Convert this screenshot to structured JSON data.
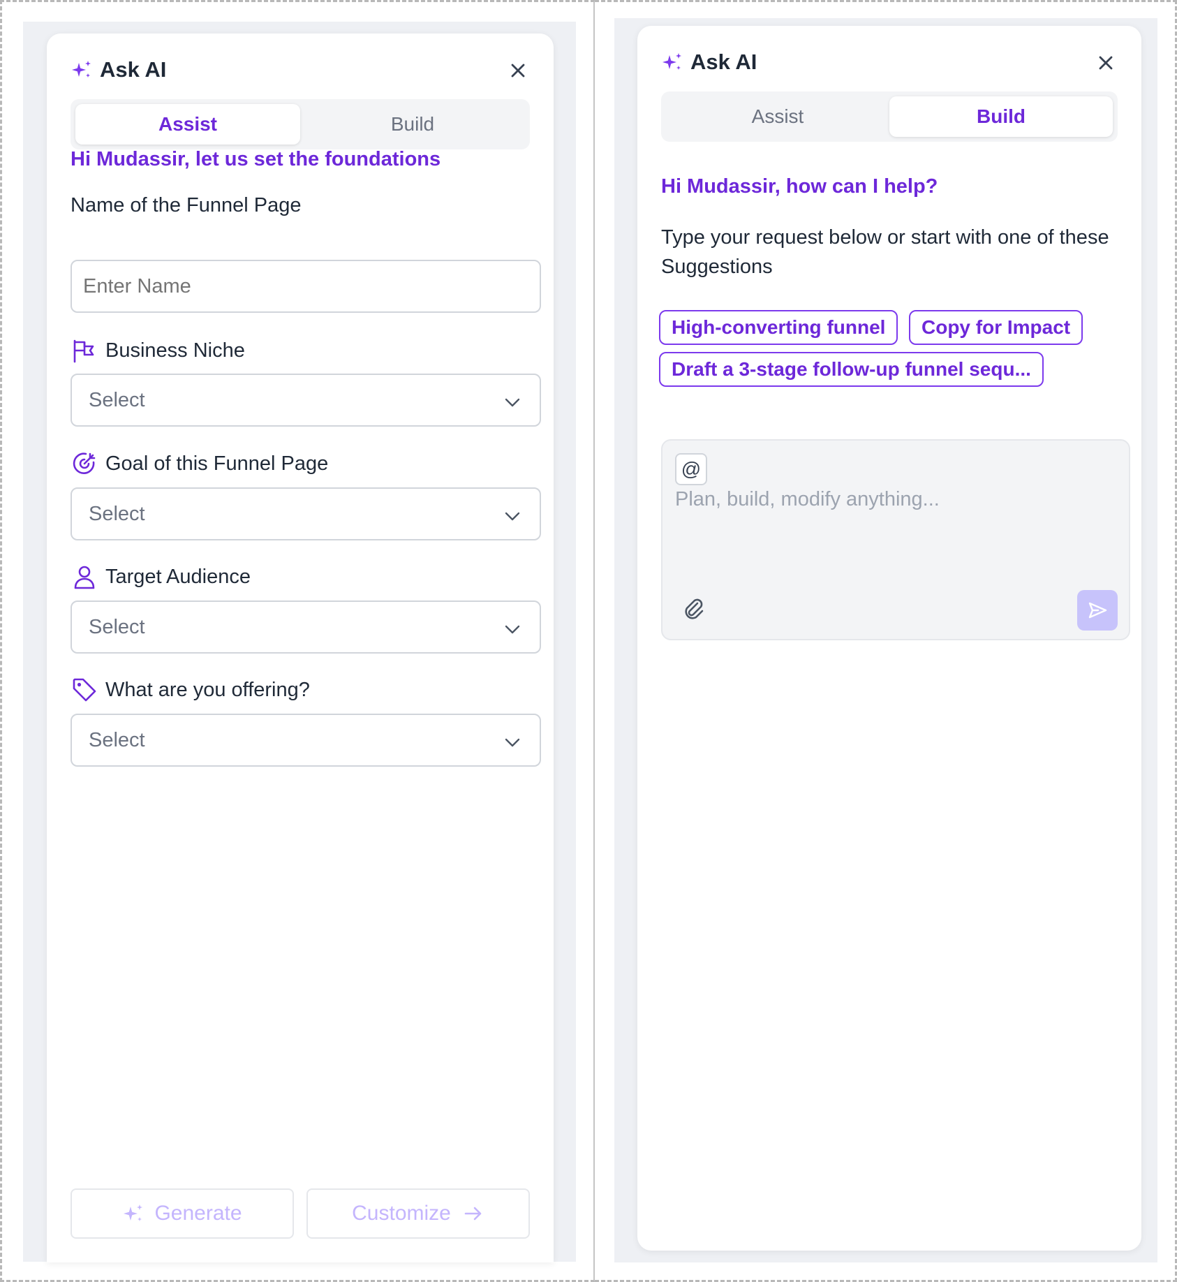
{
  "left_panel": {
    "title": "Ask AI",
    "tabs": [
      {
        "label": "Assist",
        "active": true
      },
      {
        "label": "Build",
        "active": false
      }
    ],
    "greeting": "Hi Mudassir, let us set the foundations",
    "name_field": {
      "label": "Name of the Funnel Page",
      "placeholder": "Enter Name",
      "value": ""
    },
    "fields": [
      {
        "label": "Business Niche",
        "icon": "flag-icon",
        "value": "Select"
      },
      {
        "label": "Goal of this Funnel Page",
        "icon": "target-icon",
        "value": "Select"
      },
      {
        "label": "Target Audience",
        "icon": "user-icon",
        "value": "Select"
      },
      {
        "label": "What are you offering?",
        "icon": "tag-icon",
        "value": "Select"
      }
    ],
    "generate_label": "Generate",
    "customize_label": "Customize"
  },
  "right_panel": {
    "title": "Ask AI",
    "tabs": [
      {
        "label": "Assist",
        "active": false
      },
      {
        "label": "Build",
        "active": true
      }
    ],
    "greeting": "Hi Mudassir, how can I help?",
    "description": "Type your request below or start with one of these Suggestions",
    "suggestions": [
      "High-converting funnel",
      "Copy for Impact",
      "Draft a 3-stage follow-up funnel sequ..."
    ],
    "composer": {
      "mention_symbol": "@",
      "placeholder": "Plan, build, modify anything..."
    }
  },
  "colors": {
    "accent": "#6d28d9",
    "accent_light": "#c4b5fd",
    "canvas": "#eef0f4",
    "send_disabled": "#c7c3fb"
  }
}
